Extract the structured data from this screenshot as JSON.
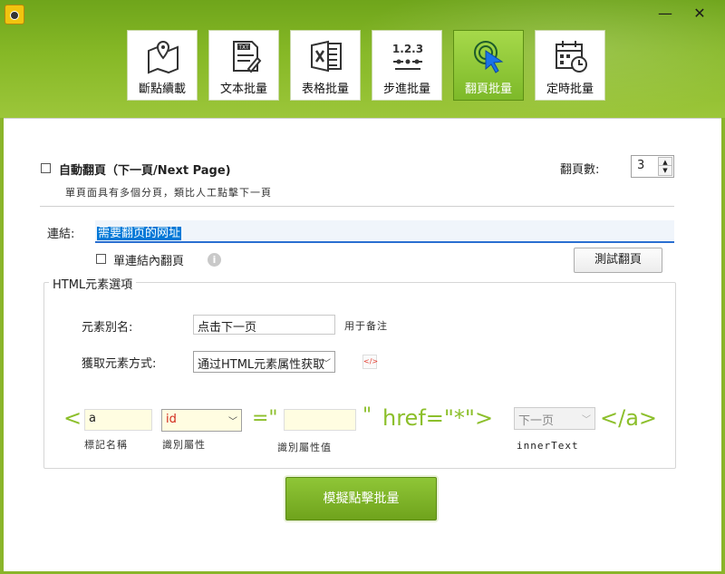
{
  "window": {
    "minimize_glyph": "—",
    "close_glyph": "✕"
  },
  "toolbar": {
    "tabs": [
      {
        "label": "斷點續載",
        "icon": "map-pin-icon"
      },
      {
        "label": "文本批量",
        "icon": "txt-file-icon"
      },
      {
        "label": "表格批量",
        "icon": "excel-icon"
      },
      {
        "label": "步進批量",
        "icon": "step-numbers-icon"
      },
      {
        "label": "翻頁批量",
        "icon": "click-cursor-icon"
      },
      {
        "label": "定時批量",
        "icon": "calendar-clock-icon"
      }
    ],
    "active_index": 4
  },
  "autopage": {
    "checkbox_label": "自動翻頁（下一頁/Next Page)",
    "checked": false,
    "note": "單頁面具有多個分頁，類比人工點擊下一頁",
    "page_count_label": "翻頁數:",
    "page_count_value": "3"
  },
  "link": {
    "label": "連結:",
    "value": "需要翻页的网址",
    "single_link_label": "單連結內翻頁",
    "test_button": "測試翻頁"
  },
  "html_element": {
    "group_title": "HTML元素選項",
    "alias_label": "元素別名:",
    "alias_value": "点击下一页",
    "alias_note": "用于备注",
    "method_label": "獲取元素方式:",
    "method_value": "通过HTML元素属性获取",
    "lt": "<",
    "tag_value": "a",
    "tag_caption": "標記名稱",
    "attr_value": "id",
    "attr_caption": "識別屬性",
    "eq_quote": "=\"",
    "attr_value_field": "",
    "attr_value_caption": "識別屬性值",
    "close_quote": "\"",
    "href_text": "href=\"*\">",
    "inner_text_value": "下一页",
    "inner_text_caption": "innerText",
    "close_tag": "</a>"
  },
  "submit_button": "模擬點擊批量",
  "colors": {
    "accent": "#8cbf2b",
    "button_green": "#7db929",
    "highlight": "#0078d7"
  }
}
